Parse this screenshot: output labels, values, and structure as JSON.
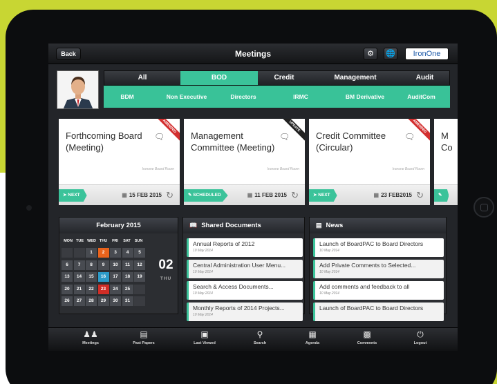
{
  "header": {
    "back_label": "Back",
    "title": "Meetings",
    "brand_label": "IronOne",
    "settings_icon": "gear-icon",
    "globe_icon": "globe-icon"
  },
  "tabs": [
    {
      "label": "All",
      "active": false
    },
    {
      "label": "BOD",
      "active": true
    },
    {
      "label": "Credit",
      "active": false
    },
    {
      "label": "Management",
      "active": false
    },
    {
      "label": "Audit",
      "active": false
    }
  ],
  "subtabs": [
    "BDM",
    "Non Executive",
    "Directors",
    "IRMC",
    "BM Derivative",
    "AuditCom"
  ],
  "cards": [
    {
      "title": "Forthcoming Board (Meeting)",
      "ribbon": "AMENDED",
      "ribbon_color": "#d32f2f",
      "room": "Ironone Board Room",
      "status": "NEXT",
      "date": "15 FEB 2015"
    },
    {
      "title": "Management Committee (Meeting)",
      "ribbon": "UPDATE",
      "ribbon_color": "#222222",
      "room": "Ironone Board Room",
      "status": "SCHEDULED",
      "date": "11 FEB 2015"
    },
    {
      "title": "Credit Committee (Circular)",
      "ribbon": "AMENDED",
      "ribbon_color": "#d32f2f",
      "room": "Ironone Board Room",
      "status": "NEXT",
      "date": "23 FEB2015"
    },
    {
      "title": "M Co",
      "ribbon": "",
      "ribbon_color": "",
      "room": "",
      "status": "",
      "date": ""
    }
  ],
  "calendar": {
    "month": "February 2015",
    "weekdays": [
      "MON",
      "TUE",
      "WED",
      "THU",
      "FRI",
      "SAT",
      "SUN"
    ],
    "weeks": [
      [
        "",
        "",
        "1",
        "2",
        "3",
        "4",
        "5"
      ],
      [
        "6",
        "7",
        "8",
        "9",
        "10",
        "11",
        "12"
      ],
      [
        "13",
        "14",
        "15",
        "16",
        "17",
        "18",
        "19"
      ],
      [
        "20",
        "21",
        "22",
        "23",
        "24",
        "25",
        ""
      ],
      [
        "26",
        "27",
        "28",
        "29",
        "30",
        "31",
        ""
      ]
    ],
    "highlight": {
      "2": "orange",
      "16": "blue",
      "23": "red"
    },
    "selected_day": "02",
    "selected_dow": "THU"
  },
  "shared_documents": {
    "title": "Shared Documents",
    "items": [
      {
        "title": "Annual Reports of 2012",
        "date": "10 May 2014"
      },
      {
        "title": "Central Administration User Menu...",
        "date": "10 May 2014"
      },
      {
        "title": "Search & Access Documents...",
        "date": "10 May 2014"
      },
      {
        "title": "Monthly Reports of 2014 Projects...",
        "date": "10 May 2014"
      }
    ]
  },
  "news": {
    "title": "News",
    "items": [
      {
        "title": "Launch of BoardPAC to Board Directors",
        "date": "10 May 2014"
      },
      {
        "title": "Add Private Comments to Selected...",
        "date": "10 May 2014"
      },
      {
        "title": "Add comments and feedback to all",
        "date": "10 May 2014"
      },
      {
        "title": "Launch of BoardPAC to Board Directors",
        "date": ""
      }
    ]
  },
  "dock": [
    {
      "label": "Meetings",
      "icon": "people-icon"
    },
    {
      "label": "Past Papers",
      "icon": "papers-icon"
    },
    {
      "label": "Last Viewed",
      "icon": "document-icon"
    },
    {
      "label": "Search",
      "icon": "search-icon"
    },
    {
      "label": "Agenda",
      "icon": "calendar-icon"
    },
    {
      "label": "Comments",
      "icon": "comments-icon"
    },
    {
      "label": "Logout",
      "icon": "power-icon"
    }
  ]
}
